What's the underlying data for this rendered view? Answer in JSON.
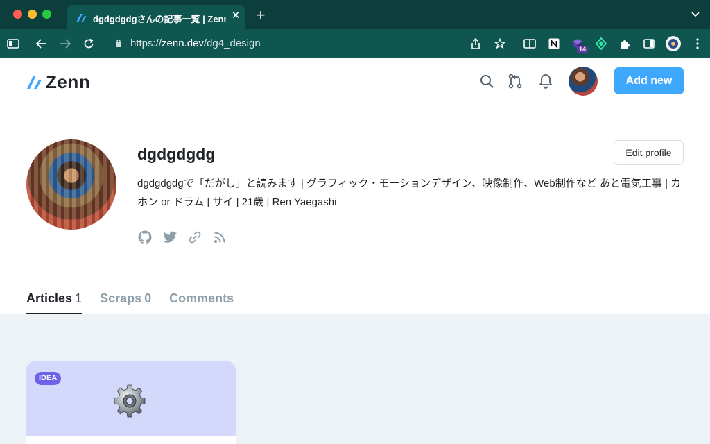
{
  "browser": {
    "tab_title": "dgdgdgdgさんの記事一覧 | Zenn",
    "tab_close": "✕",
    "new_tab": "+",
    "url_scheme": "https://",
    "url_host": "zenn.dev",
    "url_path": "/dg4_design",
    "extension_badge": "14"
  },
  "header": {
    "logo_text": "Zenn",
    "add_new_label": "Add new"
  },
  "profile": {
    "username": "dgdgdgdg",
    "edit_profile_label": "Edit profile",
    "bio": "dgdgdgdgで「だがし」と読みます | グラフィック・モーションデザイン、映像制作、Web制作など あと電気工事 | カホン or ドラム | サイ | 21歳 | Ren Yaegashi"
  },
  "tabs": [
    {
      "label": "Articles",
      "count": "1"
    },
    {
      "label": "Scraps",
      "count": "0"
    },
    {
      "label": "Comments",
      "count": ""
    }
  ],
  "articles": [
    {
      "badge": "IDEA",
      "icon": "gear-icon"
    }
  ],
  "colors": {
    "accent": "#3ea8ff",
    "browser_chrome": "#0f5650",
    "card_bg": "#d4d8fb",
    "idea_badge": "#6e63e8"
  }
}
